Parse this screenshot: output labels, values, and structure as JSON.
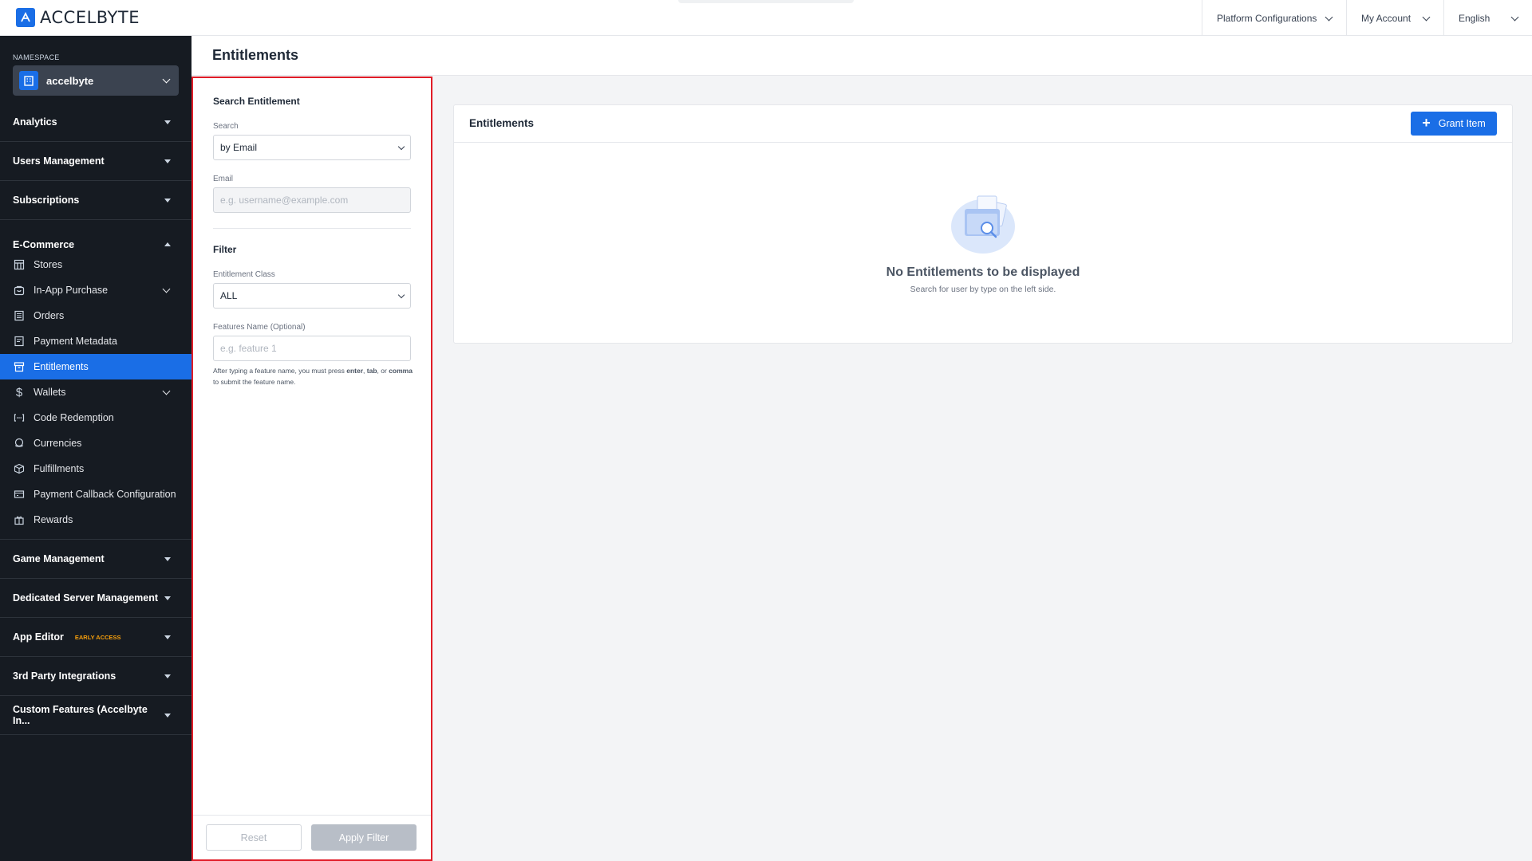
{
  "app": {
    "logo_text": "ACCELBYTE",
    "accent": "#1a6ee6",
    "sidebar_bg": "#161b22"
  },
  "topbar": {
    "items": [
      {
        "label": "Platform Configurations"
      },
      {
        "label": "My Account"
      },
      {
        "label": "English"
      }
    ]
  },
  "sidebar": {
    "namespace_label": "NAMESPACE",
    "namespace_value": "accelbyte",
    "sections": {
      "analytics": "Analytics",
      "users": "Users Management",
      "subscriptions": "Subscriptions",
      "ecommerce": "E-Commerce",
      "game": "Game Management",
      "dedicated": "Dedicated Server Management",
      "app_editor": "App Editor",
      "app_editor_badge": "EARLY ACCESS",
      "third_party": "3rd Party Integrations",
      "custom": "Custom Features (Accelbyte In..."
    },
    "ecommerce_items": [
      {
        "label": "Stores",
        "icon": "store-icon"
      },
      {
        "label": "In-App Purchase",
        "icon": "bag-icon"
      },
      {
        "label": "Orders",
        "icon": "orders-icon"
      },
      {
        "label": "Payment Metadata",
        "icon": "document-icon"
      },
      {
        "label": "Entitlements",
        "icon": "archive-icon",
        "active": true
      },
      {
        "label": "Wallets",
        "icon": "dollar-icon"
      },
      {
        "label": "Code Redemption",
        "icon": "code-icon"
      },
      {
        "label": "Currencies",
        "icon": "coins-icon"
      },
      {
        "label": "Fulfillments",
        "icon": "box-icon"
      },
      {
        "label": "Payment Callback Configuration",
        "icon": "card-icon"
      },
      {
        "label": "Rewards",
        "icon": "gift-icon"
      }
    ]
  },
  "page": {
    "title": "Entitlements"
  },
  "filter": {
    "heading": "Search Entitlement",
    "search_label": "Search",
    "search_value": "by Email",
    "email_label": "Email",
    "email_placeholder": "e.g. username@example.com",
    "filter_heading": "Filter",
    "class_label": "Entitlement Class",
    "class_value": "ALL",
    "features_label": "Features Name (Optional)",
    "features_placeholder": "e.g. feature 1",
    "help_prefix": "After typing a feature name, you must press ",
    "help_enter": "enter",
    "help_sep1": ", ",
    "help_tab": "tab",
    "help_sep2": ", or ",
    "help_comma": "comma",
    "help_suffix": " to submit the feature name.",
    "reset_label": "Reset",
    "apply_label": "Apply Filter"
  },
  "card": {
    "title": "Entitlements",
    "grant_label": "Grant Item",
    "empty_title": "No Entitlements to be displayed",
    "empty_sub": "Search for user by type on the left side."
  }
}
